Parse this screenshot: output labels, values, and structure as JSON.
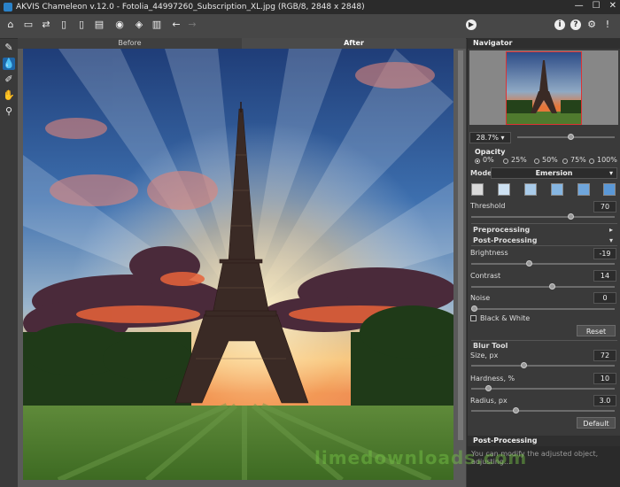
{
  "window": {
    "title": "AKVIS Chameleon v.12.0 - Fotolia_44997260_Subscription_XL.jpg (RGB/8, 2848 x 2848)"
  },
  "view_tabs": {
    "before": "Before",
    "after": "After"
  },
  "navigator": {
    "title": "Navigator",
    "zoom": "28.7%",
    "zoom_level": 0.55
  },
  "opacity": {
    "label": "Opacity",
    "options": [
      "0%",
      "25%",
      "50%",
      "75%",
      "100%"
    ],
    "selected": "0%"
  },
  "mode": {
    "label": "Mode",
    "value": "Emersion"
  },
  "swatches": [
    "#d9d9d9",
    "#cde1f2",
    "#a9cbe9",
    "#86b6e2",
    "#6fa6dc",
    "#5a98d7"
  ],
  "threshold": {
    "label": "Threshold",
    "value": "70",
    "level": 0.7
  },
  "preprocessing": {
    "label": "Preprocessing"
  },
  "postprocessing": {
    "label": "Post-Processing",
    "brightness": {
      "label": "Brightness",
      "value": "-19",
      "level": 0.4
    },
    "contrast": {
      "label": "Contrast",
      "value": "14",
      "level": 0.57
    },
    "noise": {
      "label": "Noise",
      "value": "0",
      "level": 0.0
    },
    "bw_label": "Black & White",
    "reset": "Reset"
  },
  "blur_tool": {
    "label": "Blur Tool",
    "size": {
      "label": "Size, px",
      "value": "72",
      "level": 0.36
    },
    "hardness": {
      "label": "Hardness, %",
      "value": "10",
      "level": 0.1
    },
    "radius": {
      "label": "Radius, px",
      "value": "3.0",
      "level": 0.3
    },
    "default": "Default"
  },
  "hint": {
    "title": "Post-Processing",
    "text": "You can modify the adjusted object, adjusting..."
  },
  "watermark": "limedownloads.com"
}
